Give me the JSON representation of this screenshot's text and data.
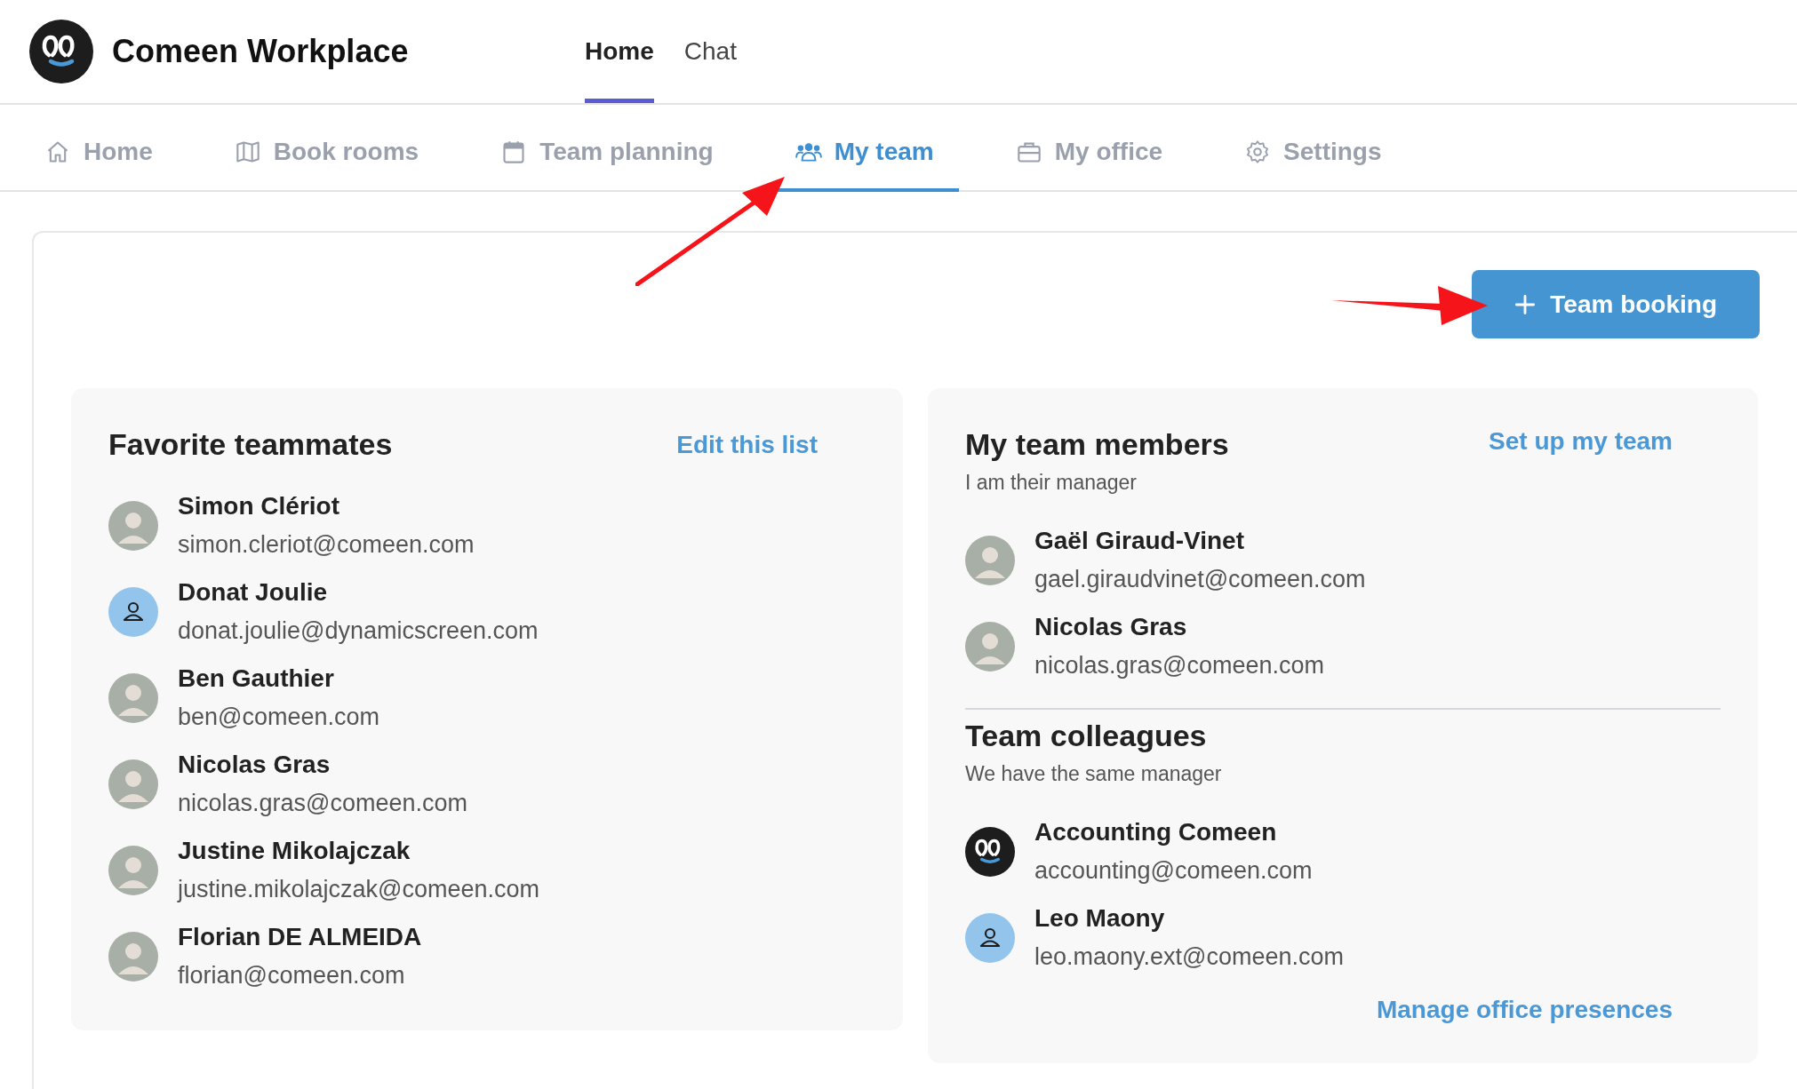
{
  "app": {
    "name": "Comeen Workplace"
  },
  "top_nav": [
    {
      "label": "Home",
      "selected": true
    },
    {
      "label": "Chat",
      "selected": false
    }
  ],
  "tabs": [
    {
      "label": "Home",
      "selected": false
    },
    {
      "label": "Book rooms",
      "selected": false
    },
    {
      "label": "Team planning",
      "selected": false
    },
    {
      "label": "My team",
      "selected": true
    },
    {
      "label": "My office",
      "selected": false
    },
    {
      "label": "Settings",
      "selected": false
    }
  ],
  "team_booking_button": "Team booking",
  "favorites": {
    "title": "Favorite teammates",
    "action": "Edit this list",
    "people": [
      {
        "name": "Simon Clériot",
        "email": "simon.cleriot@comeen.com",
        "kind": "photo"
      },
      {
        "name": "Donat Joulie",
        "email": "donat.joulie@dynamicscreen.com",
        "kind": "placeholder"
      },
      {
        "name": "Ben Gauthier",
        "email": "ben@comeen.com",
        "kind": "photo"
      },
      {
        "name": "Nicolas Gras",
        "email": "nicolas.gras@comeen.com",
        "kind": "photo"
      },
      {
        "name": "Justine Mikolajczak",
        "email": "justine.mikolajczak@comeen.com",
        "kind": "photo"
      },
      {
        "name": "Florian DE ALMEIDA",
        "email": "florian@comeen.com",
        "kind": "photo"
      }
    ]
  },
  "team": {
    "title": "My team members",
    "subtitle": "I am their manager",
    "action": "Set up my team",
    "people": [
      {
        "name": "Gaël Giraud-Vinet",
        "email": "gael.giraudvinet@comeen.com",
        "kind": "photo"
      },
      {
        "name": "Nicolas Gras",
        "email": "nicolas.gras@comeen.com",
        "kind": "photo"
      }
    ]
  },
  "colleagues": {
    "title": "Team colleagues",
    "subtitle": "We have the same manager",
    "people": [
      {
        "name": "Accounting Comeen",
        "email": "accounting@comeen.com",
        "kind": "logo"
      },
      {
        "name": "Leo Maony",
        "email": "leo.maony.ext@comeen.com",
        "kind": "placeholder"
      }
    ]
  },
  "manage_link": "Manage office presences"
}
